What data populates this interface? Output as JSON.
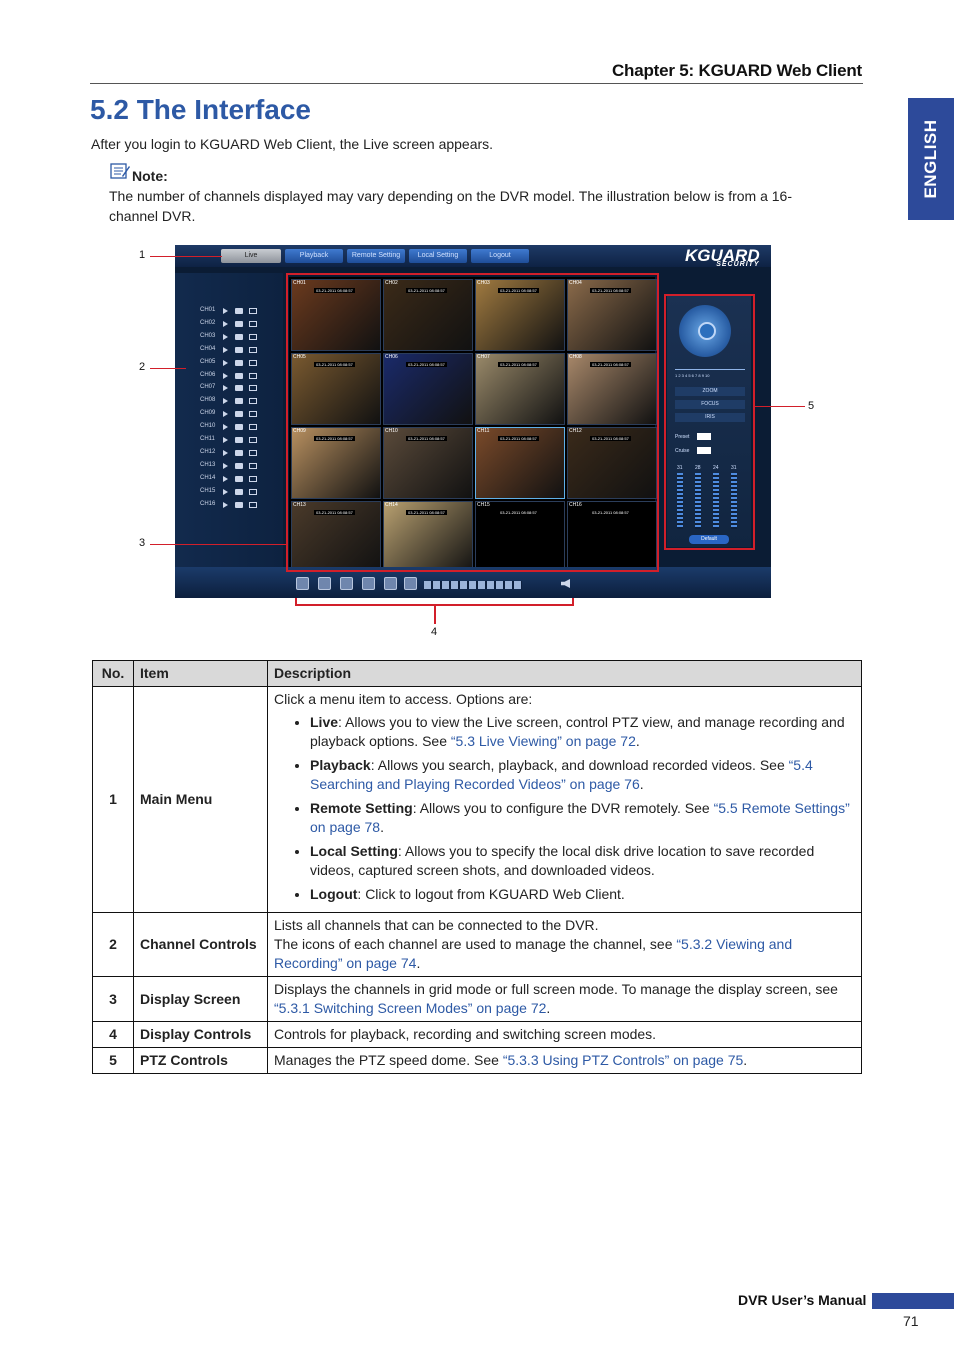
{
  "header": {
    "chapter": "Chapter 5: KGUARD Web Client",
    "side_tab": "ENGLISH"
  },
  "section": {
    "title": "5.2 The Interface",
    "intro": "After you login to KGUARD Web Client, the Live screen appears."
  },
  "note": {
    "label": "Note:",
    "text": "The number of channels displayed may vary depending on the DVR model. The illustration below is from a 16-channel DVR."
  },
  "screenshot": {
    "menu": [
      "Live",
      "Playback",
      "Remote Setting",
      "Local Setting",
      "Logout"
    ],
    "logo": "KGUARD",
    "logo_sub": "SECURITY",
    "channels": [
      "CH01",
      "CH02",
      "CH03",
      "CH04",
      "CH05",
      "CH06",
      "CH07",
      "CH08",
      "CH09",
      "CH10",
      "CH11",
      "CH12",
      "CH13",
      "CH14",
      "CH15",
      "CH16"
    ],
    "timestamp": "03-21-2011 08:08:57",
    "ptz": {
      "zoom": "ZOOM",
      "focus": "FOCUS",
      "iris": "IRIS",
      "preset": "Preset",
      "cruise": "Cruise",
      "default": "Default",
      "speed_scale": "1 2 3 4 5 6 7 8 9 10",
      "levels": [
        "31",
        "28",
        "24",
        "31"
      ]
    },
    "callouts": [
      "1",
      "2",
      "3",
      "4",
      "5"
    ]
  },
  "table": {
    "headers": [
      "No.",
      "Item",
      "Description"
    ],
    "rows": [
      {
        "no": "1",
        "item": "Main Menu",
        "intro": "Click a menu item to access. Options are:",
        "bullets": [
          {
            "term": "Live",
            "text": ": Allows you to view the Live screen, control PTZ view, and manage recording and playback options. See ",
            "link": "“5.3 Live Viewing” on page 72",
            "end": "."
          },
          {
            "term": "Playback",
            "text": ": Allows you search, playback, and download recorded videos. See ",
            "link": "“5.4 Searching and Playing Recorded Videos” on page 76",
            "end": "."
          },
          {
            "term": "Remote Setting",
            "text": ": Allows you to configure the DVR remotely. See ",
            "link": "“5.5 Remote Settings” on page 78",
            "end": "."
          },
          {
            "term": "Local Setting",
            "text": ": Allows you to specify the local disk drive location to save recorded videos, captured screen shots, and downloaded videos.",
            "link": "",
            "end": ""
          },
          {
            "term": "Logout",
            "text": ": Click to logout from KGUARD Web Client.",
            "link": "",
            "end": ""
          }
        ]
      },
      {
        "no": "2",
        "item": "Channel Controls",
        "line1": "Lists all channels that can be connected to the DVR.",
        "text": "The icons of each channel are used to manage the channel, see ",
        "link": "“5.3.2 Viewing and Recording” on page 74",
        "end": "."
      },
      {
        "no": "3",
        "item": "Display Screen",
        "text": "Displays the channels in grid mode or full screen mode. To manage the display screen, see ",
        "link": "“5.3.1 Switching Screen Modes” on page 72",
        "end": "."
      },
      {
        "no": "4",
        "item": "Display Controls",
        "text": "Controls for playback, recording and switching screen modes."
      },
      {
        "no": "5",
        "item": "PTZ Controls",
        "text": "Manages the PTZ speed dome. See ",
        "link": "“5.3.3 Using PTZ Controls” on page 75",
        "end": "."
      }
    ]
  },
  "footer": {
    "manual": "DVR User’s Manual",
    "page": "71"
  }
}
